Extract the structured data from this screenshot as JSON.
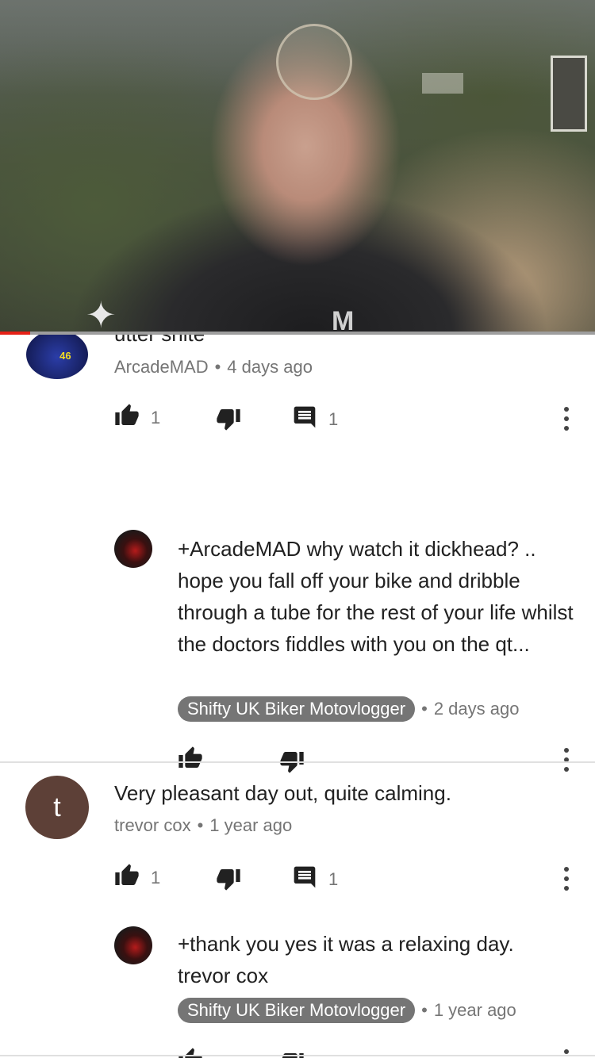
{
  "player": {
    "progress_fraction": 0.05,
    "colors": {
      "progress": "#e62117",
      "track": "#9e9e9e"
    }
  },
  "comments": [
    {
      "text_clipped": "utter shite",
      "author": "ArcadeMAD",
      "time": "4 days ago",
      "likes": "1",
      "replies": "1",
      "reply": {
        "text": "+ArcadeMAD why watch it dickhead? .. hope you fall off your bike and dribble through a tube for the rest of your life whilst the doctors fiddles with you on the qt...",
        "author": "Shifty UK Biker Motovlogger",
        "time": "2 days ago"
      }
    },
    {
      "avatar_letter": "t",
      "text": "Very pleasant day out, quite calming.",
      "author": "trevor cox",
      "time": "1 year ago",
      "likes": "1",
      "replies": "1",
      "reply": {
        "text": "+thank you yes it was a relaxing day. trevor cox",
        "author": "Shifty UK Biker Motovlogger",
        "time": "1 year ago"
      }
    }
  ],
  "icons": {
    "like": "thumb-up-icon",
    "dislike": "thumb-down-icon",
    "reply": "comment-icon",
    "more": "more-vert-icon"
  },
  "separator": "•"
}
